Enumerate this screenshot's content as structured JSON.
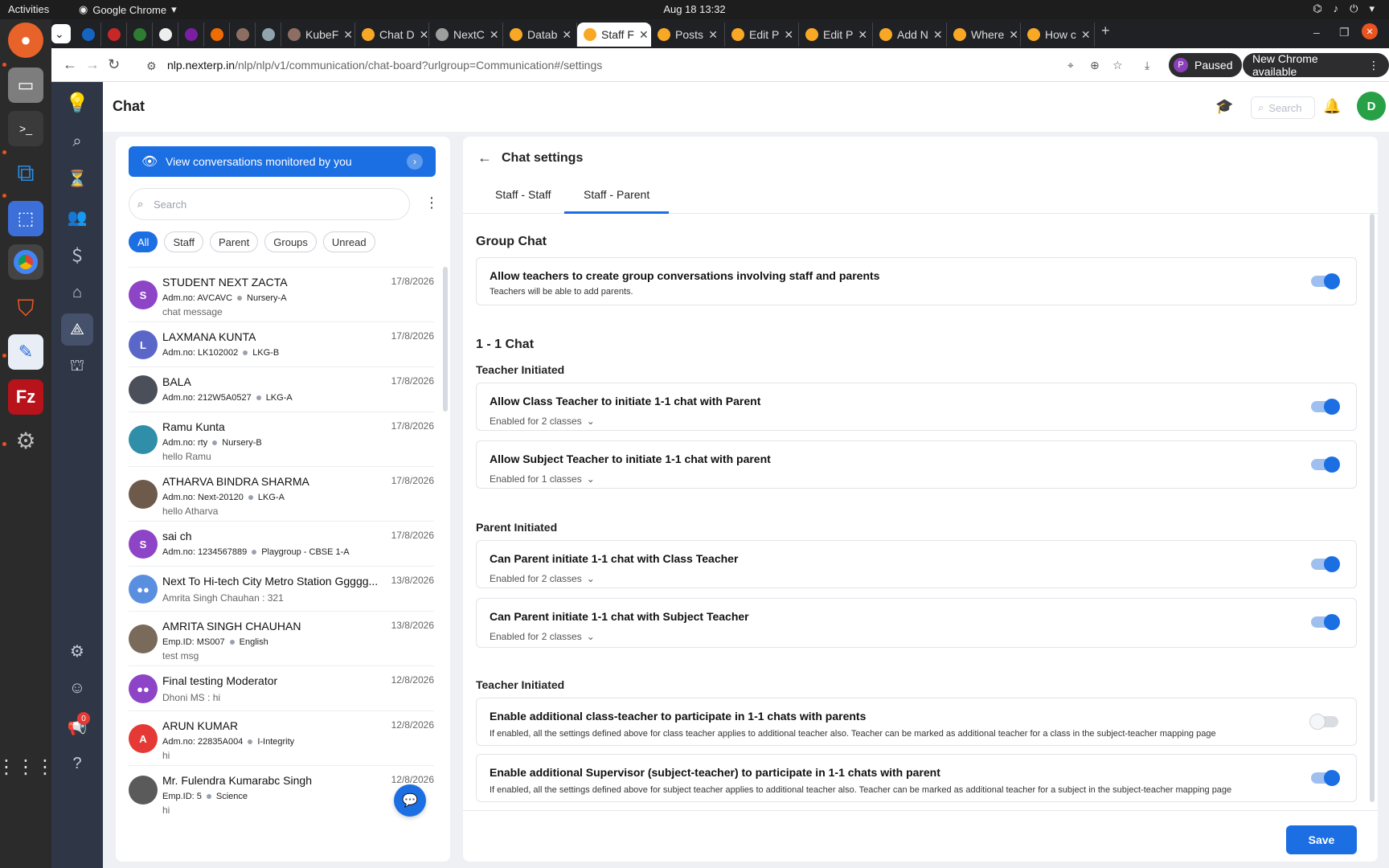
{
  "system": {
    "activities": "Activities",
    "app_name": "Google Chrome",
    "datetime": "Aug 18  13:32"
  },
  "browser": {
    "tabs": [
      {
        "label": "",
        "color": "#1565c0"
      },
      {
        "label": "",
        "color": "#c62828"
      },
      {
        "label": "",
        "color": "#2e7d32"
      },
      {
        "label": "",
        "color": "#eeeeee"
      },
      {
        "label": "",
        "color": "#7b1fa2"
      },
      {
        "label": "",
        "color": "#ef6c00"
      },
      {
        "label": "",
        "color": "#8d6e63"
      },
      {
        "label": "",
        "color": "#90a4ae"
      },
      {
        "label": "KubeF",
        "color": "#8d6e63"
      },
      {
        "label": "Chat D",
        "color": "#f9a825"
      },
      {
        "label": "NextC",
        "color": "#9e9e9e"
      },
      {
        "label": "Datab",
        "color": "#f9a825"
      },
      {
        "label": "Staff F",
        "color": "#f9a825"
      },
      {
        "label": "Posts",
        "color": "#f9a825"
      },
      {
        "label": "Edit P",
        "color": "#f9a825"
      },
      {
        "label": "Edit P",
        "color": "#f9a825"
      },
      {
        "label": "Add N",
        "color": "#f9a825"
      },
      {
        "label": "Where",
        "color": "#f9a825"
      },
      {
        "label": "How c",
        "color": "#f9a825"
      }
    ],
    "url_host": "nlp.nexterp.in",
    "url_path": "/nlp/nlp/v1/communication/chat-board?urlgroup=Communication#/settings",
    "paused_label": "Paused",
    "profile_initial": "P",
    "new_chrome_label": "New Chrome available"
  },
  "app": {
    "title": "Chat",
    "search_placeholder": "Search",
    "user_initial": "D",
    "notification_count": "0"
  },
  "chat_list": {
    "monitor_label": "View conversations monitored by you",
    "search_placeholder": "Search",
    "filters": [
      "All",
      "Staff",
      "Parent",
      "Groups",
      "Unread"
    ],
    "rows": [
      {
        "name": "STUDENT NEXT ZACTA",
        "date": "17/8/2026",
        "id": "Adm.no: AVCAVC",
        "class": "Nursery-A",
        "msg": "chat message",
        "initial": "S",
        "avatar_color": "#8e44c6"
      },
      {
        "name": "LAXMANA KUNTA",
        "date": "17/8/2026",
        "id": "Adm.no: LK102002",
        "class": "LKG-B",
        "msg": "",
        "initial": "L",
        "avatar_color": "#5a67c8"
      },
      {
        "name": "BALA",
        "date": "17/8/2026",
        "id": "Adm.no: 212W5A0527",
        "class": "LKG-A",
        "msg": "",
        "initial": "",
        "avatar_color": "#4a4f5a"
      },
      {
        "name": "Ramu Kunta",
        "date": "17/8/2026",
        "id": "Adm.no: rty",
        "class": "Nursery-B",
        "msg": "hello Ramu",
        "initial": "",
        "avatar_color": "#2f8fa8"
      },
      {
        "name": "ATHARVA BINDRA SHARMA",
        "date": "17/8/2026",
        "id": "Adm.no: Next-20120",
        "class": "LKG-A",
        "msg": "hello Atharva",
        "initial": "",
        "avatar_color": "#6d5a4a"
      },
      {
        "name": "sai ch",
        "date": "17/8/2026",
        "id": "Adm.no: 1234567889",
        "class": "Playgroup - CBSE 1-A",
        "msg": "",
        "initial": "S",
        "avatar_color": "#8e44c6"
      },
      {
        "name": "Next To Hi-tech City Metro Station Ggggg...",
        "date": "13/8/2026",
        "id": "",
        "class": "",
        "msg": "Amrita Singh Chauhan : 321",
        "initial": "●●",
        "avatar_color": "#5a8fe0"
      },
      {
        "name": "AMRITA SINGH CHAUHAN",
        "date": "13/8/2026",
        "id": "Emp.ID: MS007",
        "class": "English",
        "msg": "test msg",
        "initial": "",
        "avatar_color": "#7a6a5a"
      },
      {
        "name": "Final testing Moderator",
        "date": "12/8/2026",
        "id": "",
        "class": "",
        "msg": "Dhoni MS : hi",
        "initial": "●●",
        "avatar_color": "#8e44c6"
      },
      {
        "name": "ARUN KUMAR",
        "date": "12/8/2026",
        "id": "Adm.no: 22835A004",
        "class": "I-Integrity",
        "msg": "hi",
        "initial": "A",
        "avatar_color": "#e53935"
      },
      {
        "name": "Mr. Fulendra Kumarabc Singh",
        "date": "12/8/2026",
        "id": "Emp.ID: 5",
        "class": "Science",
        "msg": "hi",
        "initial": "",
        "avatar_color": "#5a5a5a"
      }
    ]
  },
  "settings": {
    "title": "Chat settings",
    "tabs": [
      "Staff - Staff",
      "Staff - Parent"
    ],
    "group_chat": {
      "heading": "Group Chat",
      "title": "Allow teachers to create group conversations involving staff and parents",
      "sub": "Teachers will be able to add parents.",
      "enabled": true
    },
    "one_one": {
      "heading": "1 - 1 Chat",
      "teacher_initiated_heading": "Teacher Initiated",
      "class_teacher": {
        "title": "Allow Class Teacher to initiate 1-1 chat with Parent",
        "dropdown": "Enabled for 2 classes",
        "enabled": true
      },
      "subject_teacher": {
        "title": "Allow Subject Teacher to initiate 1-1 chat with parent",
        "dropdown": "Enabled for 1 classes",
        "enabled": true
      },
      "parent_initiated_heading": "Parent Initiated",
      "parent_class": {
        "title": "Can Parent initiate 1-1 chat with Class Teacher",
        "dropdown": "Enabled for 2 classes",
        "enabled": true
      },
      "parent_subject": {
        "title": "Can Parent initiate 1-1 chat with Subject Teacher",
        "dropdown": "Enabled for 2 classes",
        "enabled": true
      },
      "teacher_initiated_heading_2": "Teacher Initiated",
      "additional_class": {
        "title": "Enable additional class-teacher to participate in 1-1 chats with parents",
        "sub": "If enabled, all the settings defined above for class teacher applies to additional teacher also. Teacher can be marked as additional teacher for a class in the subject-teacher mapping page",
        "enabled": false
      },
      "additional_supervisor": {
        "title": "Enable additional Supervisor (subject-teacher) to participate in 1-1 chats with parent",
        "sub": "If enabled, all the settings defined above for subject teacher applies to additional teacher also. Teacher can be marked as additional teacher for a subject in the subject-teacher mapping page",
        "enabled": true
      }
    },
    "save_label": "Save"
  },
  "colors": {
    "accent": "#1b6fe3",
    "rail": "#2f3746"
  }
}
